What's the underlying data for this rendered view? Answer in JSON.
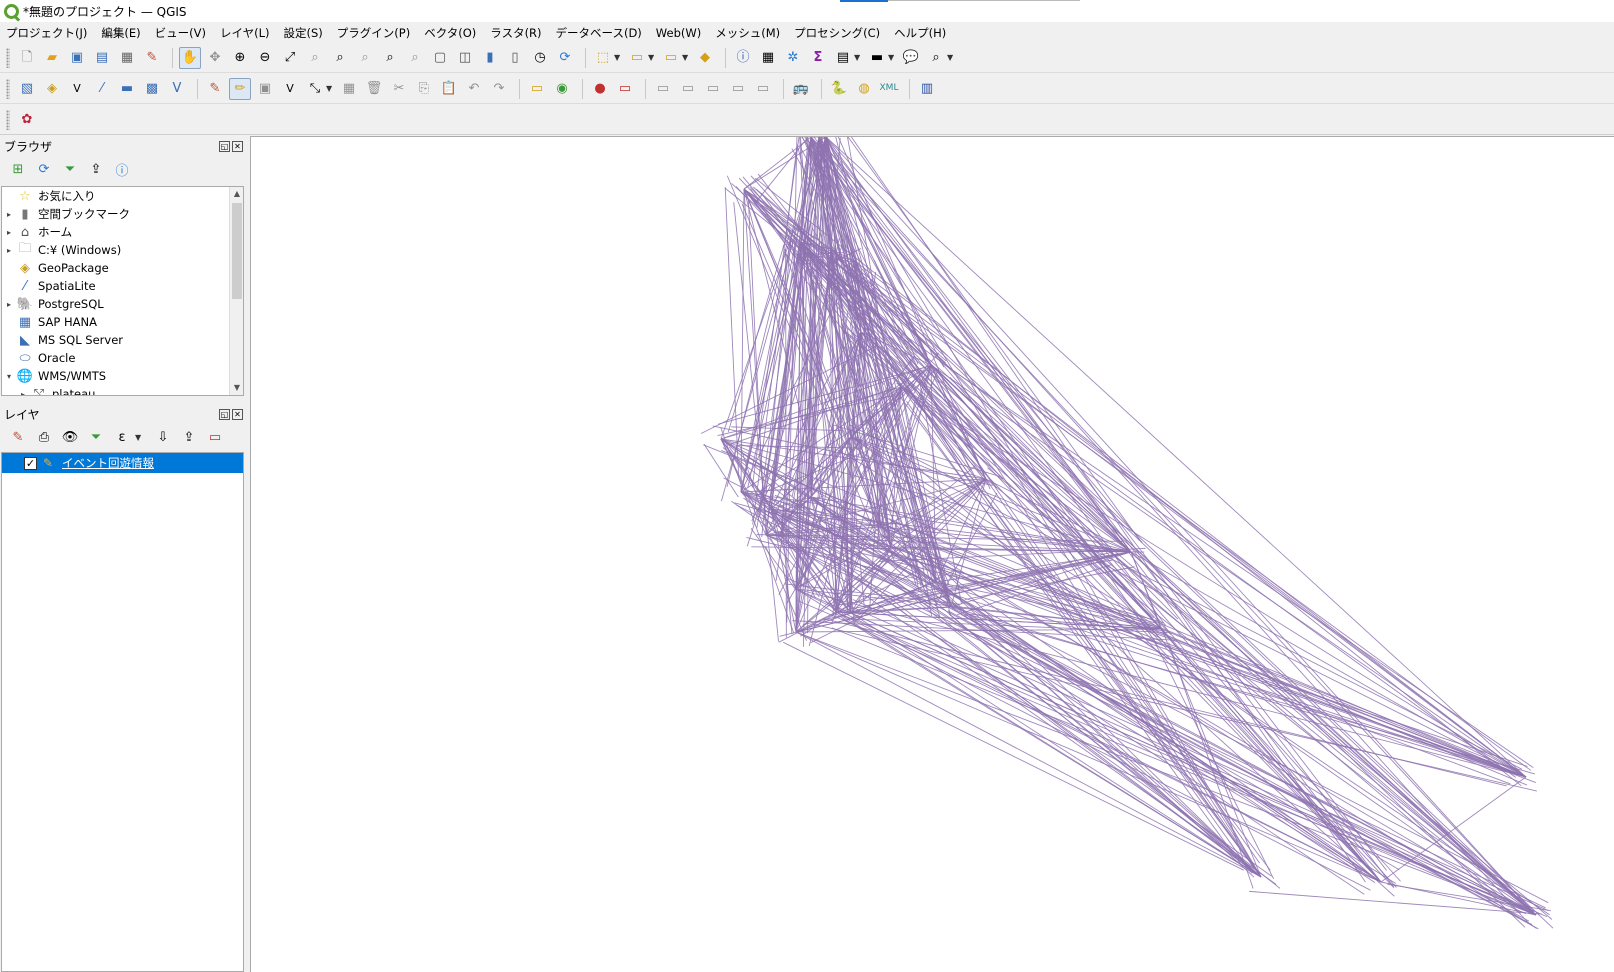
{
  "window": {
    "title": "*無題のプロジェクト — QGIS"
  },
  "menu": [
    "プロジェクト(J)",
    "編集(E)",
    "ビュー(V)",
    "レイヤ(L)",
    "設定(S)",
    "プラグイン(P)",
    "ベクタ(O)",
    "ラスタ(R)",
    "データベース(D)",
    "Web(W)",
    "メッシュ(M)",
    "プロセシング(C)",
    "ヘルプ(H)"
  ],
  "browser": {
    "title": "ブラウザ",
    "items": [
      {
        "label": "お気に入り",
        "icon": "star-icon",
        "expand": ""
      },
      {
        "label": "空間ブックマーク",
        "icon": "bookmark-icon",
        "expand": "▸"
      },
      {
        "label": "ホーム",
        "icon": "home-icon",
        "expand": "▸"
      },
      {
        "label": "C:¥ (Windows)",
        "icon": "folder-icon",
        "expand": "▸"
      },
      {
        "label": "GeoPackage",
        "icon": "geopackage-icon",
        "expand": ""
      },
      {
        "label": "SpatiaLite",
        "icon": "spatialite-icon",
        "expand": ""
      },
      {
        "label": "PostgreSQL",
        "icon": "postgresql-icon",
        "expand": "▸"
      },
      {
        "label": "SAP HANA",
        "icon": "sap-hana-icon",
        "expand": ""
      },
      {
        "label": "MS SQL Server",
        "icon": "mssql-icon",
        "expand": ""
      },
      {
        "label": "Oracle",
        "icon": "oracle-icon",
        "expand": ""
      },
      {
        "label": "WMS/WMTS",
        "icon": "globe-icon",
        "expand": "▾"
      },
      {
        "label": "plateau",
        "icon": "wms-layer-icon",
        "expand": "▸"
      }
    ]
  },
  "layers": {
    "title": "レイヤ",
    "items": [
      {
        "label": "イベント回遊情報",
        "checked": "✓"
      }
    ]
  },
  "map": {
    "line_color": "#8e73b0"
  }
}
